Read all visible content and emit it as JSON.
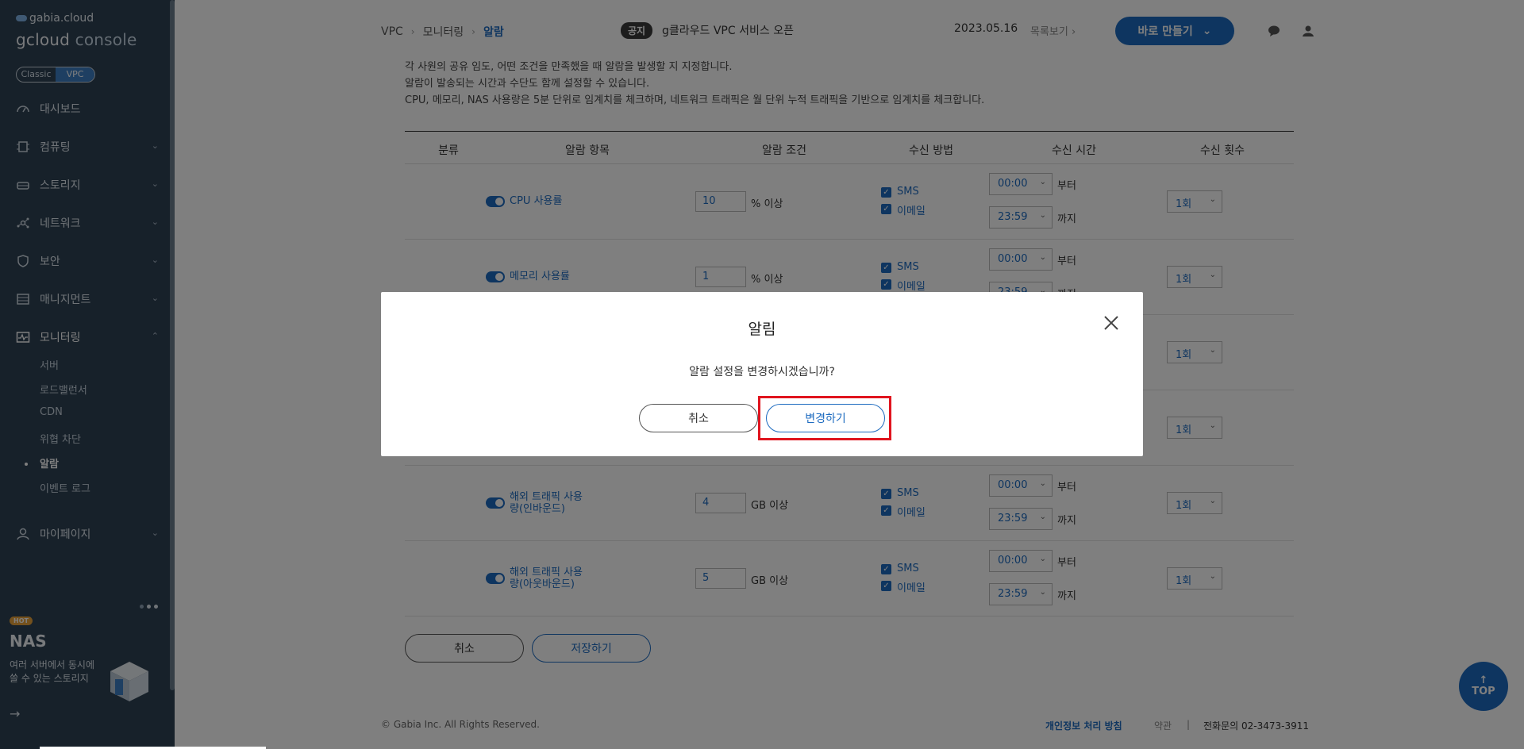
{
  "sidebar": {
    "brand_small": "gabia.cloud",
    "brand_main": "gcloud",
    "brand_console": "console",
    "platform_tabs": [
      "Classic",
      "VPC"
    ],
    "items": [
      {
        "label": "대시보드",
        "icon": "dashboard-icon"
      },
      {
        "label": "컴퓨팅",
        "icon": "chip-icon"
      },
      {
        "label": "스토리지",
        "icon": "storage-icon"
      },
      {
        "label": "네트워크",
        "icon": "network-icon"
      },
      {
        "label": "보안",
        "icon": "shield-icon"
      },
      {
        "label": "매니지먼트",
        "icon": "management-icon"
      },
      {
        "label": "모니터링",
        "icon": "monitor-icon"
      },
      {
        "label": "마이페이지",
        "icon": "user-icon"
      }
    ],
    "monitoring_sub": [
      "서버",
      "로드밸런서",
      "CDN",
      "위협 차단",
      "알람",
      "이벤트 로그"
    ],
    "promo": {
      "badge": "HOT",
      "title": "NAS",
      "desc_line1": "여러 서버에서 동시에",
      "desc_line2": "쓸 수 있는 스토리지"
    }
  },
  "header": {
    "breadcrumb": [
      "VPC",
      "모니터링",
      "알람"
    ],
    "notice_badge": "공지",
    "notice_text": "g클라우드 VPC 서비스 오픈",
    "notice_date": "2023.05.16",
    "notice_more": "목록보기",
    "create_button": "바로 만들기"
  },
  "description": [
    "각 사원의 공유 임도, 어떤 조건을 만족했을 때 알람을 발생할 지 지정합니다.",
    "알람이 발송되는 시간과 수단도 함께 설정할 수 있습니다.",
    "CPU, 메모리, NAS 사용량은 5분 단위로 임계치를 체크하며, 네트워크 트래픽은 월 단위 누적 트래픽을 기반으로 임계치를 체크합니다."
  ],
  "table": {
    "headers": [
      "분류",
      "알람 항목",
      "알람 조건",
      "수신 방법",
      "수신 시간",
      "수신 횟수"
    ],
    "rows": [
      {
        "name_line1": "CPU 사용률",
        "name_line2": "",
        "value": "10",
        "unit": "% 이상",
        "sms": "SMS",
        "email": "이메일",
        "from": "00:00",
        "from_lbl": "부터",
        "to": "23:59",
        "to_lbl": "까지",
        "count": "1회"
      },
      {
        "name_line1": "메모리 사용률",
        "name_line2": "",
        "value": "1",
        "unit": "% 이상",
        "sms": "SMS",
        "email": "이메일",
        "from": "00:00",
        "from_lbl": "부터",
        "to": "23:59",
        "to_lbl": "까지",
        "count": "1회"
      },
      {
        "name_line1": "",
        "name_line2": "",
        "value": "",
        "unit": "",
        "sms": "",
        "email": "",
        "from": "",
        "from_lbl": "",
        "to": "",
        "to_lbl": "",
        "count": "1회"
      },
      {
        "name_line1": "",
        "name_line2": "",
        "value": "",
        "unit": "",
        "sms": "",
        "email": "",
        "from": "",
        "from_lbl": "",
        "to": "",
        "to_lbl": "",
        "count": "1회"
      },
      {
        "name_line1": "해외 트래픽 사용",
        "name_line2": "량(인바운드)",
        "value": "4",
        "unit": "GB 이상",
        "sms": "SMS",
        "email": "이메일",
        "from": "00:00",
        "from_lbl": "부터",
        "to": "23:59",
        "to_lbl": "까지",
        "count": "1회"
      },
      {
        "name_line1": "해외 트래픽 사용",
        "name_line2": "량(아웃바운드)",
        "value": "5",
        "unit": "GB 이상",
        "sms": "SMS",
        "email": "이메일",
        "from": "00:00",
        "from_lbl": "부터",
        "to": "23:59",
        "to_lbl": "까지",
        "count": "1회"
      }
    ]
  },
  "actions": {
    "cancel": "취소",
    "save": "저장하기"
  },
  "footer": {
    "copyright": "© Gabia Inc. All Rights Reserved.",
    "privacy": "개인정보 처리 방침",
    "terms": "약관",
    "contact_label": "전화문의",
    "contact_number": "02-3473-3911",
    "top": "TOP"
  },
  "modal": {
    "title": "알림",
    "message": "알람 설정을 변경하시겠습니까?",
    "cancel": "취소",
    "confirm": "변경하기"
  },
  "colors": {
    "accent": "#1d6bc0",
    "sidebar": "#2e4255",
    "highlight": "#e0141e"
  }
}
